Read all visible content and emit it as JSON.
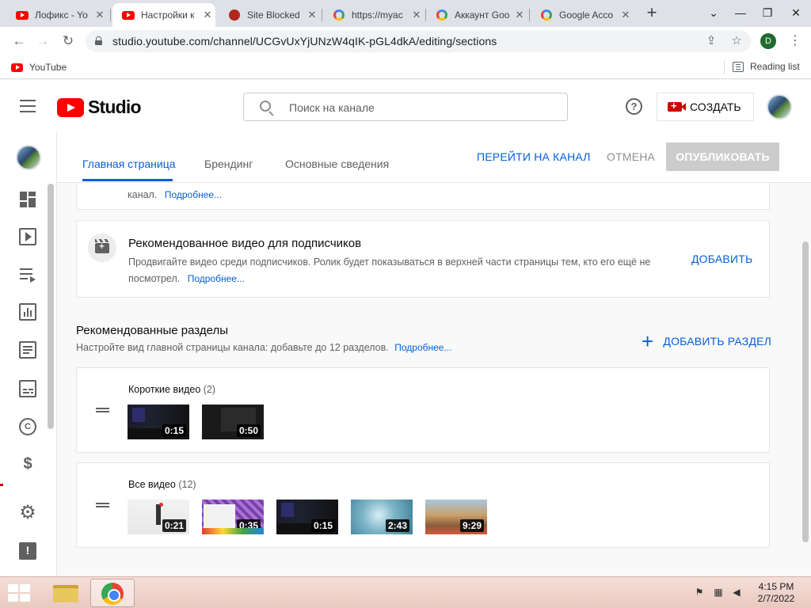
{
  "browser": {
    "tabs": [
      {
        "title": "Лофикс - Yo",
        "favicon": "youtube-icon",
        "active": false
      },
      {
        "title": "Настройки к",
        "favicon": "youtube-icon",
        "active": true
      },
      {
        "title": "Site Blocked",
        "favicon": "globe-icon",
        "active": false
      },
      {
        "title": "https://myac",
        "favicon": "google-icon",
        "active": false
      },
      {
        "title": "Аккаунт Goo",
        "favicon": "google-icon",
        "active": false
      },
      {
        "title": "Google Acco",
        "favicon": "google-icon",
        "active": false
      }
    ],
    "new_tab_label": "+",
    "url": "studio.youtube.com/channel/UCGvUxYjUNzW4qIK-pGL4dkA/editing/sections",
    "profile_initial": "D",
    "bookmarks": [
      {
        "label": "YouTube",
        "icon": "youtube-icon"
      }
    ],
    "reading_list_label": "Reading list"
  },
  "studio": {
    "logo_text": "Studio",
    "search_placeholder": "Поиск на канале",
    "create_label": "СОЗДАТЬ",
    "help_glyph": "?"
  },
  "sidebar": {
    "items": [
      {
        "name": "dashboard",
        "icon": "dashboard-icon"
      },
      {
        "name": "content",
        "icon": "content-icon"
      },
      {
        "name": "playlists",
        "icon": "playlist-icon"
      },
      {
        "name": "analytics",
        "icon": "analytics-icon"
      },
      {
        "name": "comments",
        "icon": "comments-icon"
      },
      {
        "name": "subtitles",
        "icon": "subtitles-icon"
      },
      {
        "name": "copyright",
        "icon": "copyright-icon",
        "glyph": "C"
      },
      {
        "name": "monetization",
        "icon": "dollar-icon",
        "glyph": "$"
      },
      {
        "name": "settings",
        "icon": "gear-icon",
        "glyph": "⚙"
      },
      {
        "name": "feedback",
        "icon": "feedback-icon",
        "glyph": "!"
      }
    ]
  },
  "customization": {
    "tabs": [
      {
        "label": "Главная страница",
        "active": true
      },
      {
        "label": "Брендинг",
        "active": false
      },
      {
        "label": "Основные сведения",
        "active": false
      }
    ],
    "go_to_channel": "ПЕРЕЙТИ НА КАНАЛ",
    "cancel": "ОТМЕНА",
    "publish": "ОПУБЛИКОВАТЬ",
    "top_card": {
      "text": "канал.",
      "more": "Подробнее..."
    },
    "featured_card": {
      "title": "Рекомендованное видео для подписчиков",
      "desc": "Продвигайте видео среди подписчиков. Ролик будет показываться в верхней части страницы тем, кто его ещё не посмотрел.",
      "more": "Подробнее...",
      "action": "ДОБАВИТЬ"
    },
    "sections_title": "Рекомендованные разделы",
    "sections_desc": "Настройте вид главной страницы канала: добавьте до 12 разделов.",
    "sections_more": "Подробнее...",
    "add_section": "ДОБАВИТЬ РАЗДЕЛ",
    "shelves": [
      {
        "title": "Короткие видео",
        "count": "(2)",
        "videos": [
          {
            "duration": "0:15"
          },
          {
            "duration": "0:50"
          }
        ]
      },
      {
        "title": "Все видео",
        "count": "(12)",
        "videos": [
          {
            "duration": "0:21"
          },
          {
            "duration": "0:35"
          },
          {
            "duration": "0:15"
          },
          {
            "duration": "2:43"
          },
          {
            "duration": "9:29"
          }
        ]
      }
    ]
  },
  "taskbar": {
    "time": "4:15 PM",
    "date": "2/7/2022",
    "apps": [
      {
        "name": "file-explorer",
        "icon": "folder-icon"
      },
      {
        "name": "chrome",
        "icon": "chrome-icon"
      }
    ]
  },
  "colors": {
    "accent": "#065fd4",
    "brand_red": "#ff0000",
    "create_red": "#cc0000",
    "disabled": "#cccccc"
  }
}
